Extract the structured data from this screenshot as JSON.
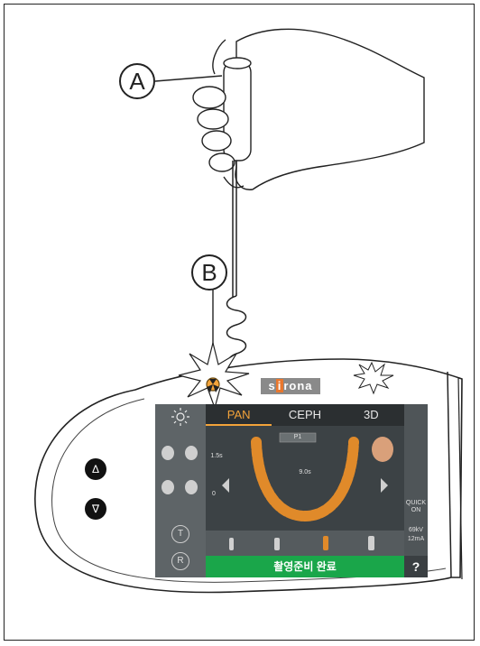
{
  "labels": {
    "a": "A",
    "b": "B"
  },
  "brand": {
    "pre": "s",
    "hl": "i",
    "post": "rona"
  },
  "screen": {
    "tabs": [
      {
        "label": "PAN"
      },
      {
        "label": "CEPH"
      },
      {
        "label": "3D"
      }
    ],
    "status_text": "촬영준비 완료",
    "quick_on": "QUICK ON",
    "kv": "69kV",
    "ma": "12mA",
    "help": "?",
    "t_button": "T",
    "r_button": "R",
    "value_small": "1.5s",
    "value_mid": "9.0s",
    "value_top": "P1",
    "value_zero": "0"
  },
  "controls": {
    "up": "Δ",
    "down": "∇"
  },
  "colors": {
    "accent": "#f3a33a",
    "status_green": "#1aa64a",
    "brand_orange": "#e8772e"
  }
}
